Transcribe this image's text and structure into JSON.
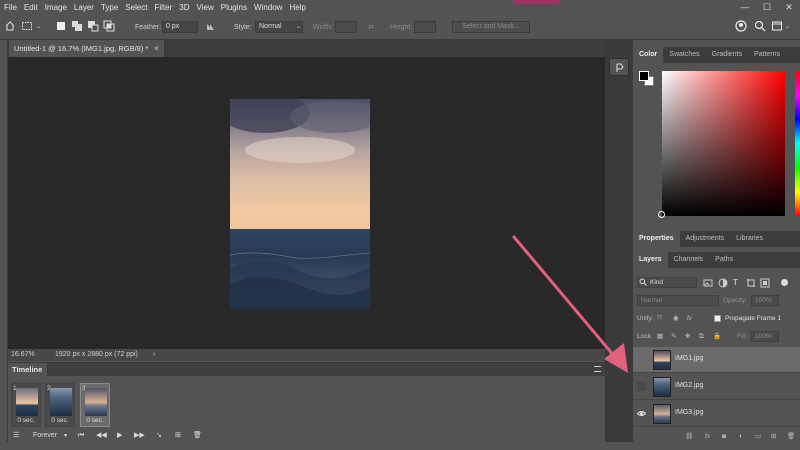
{
  "menu": [
    "File",
    "Edit",
    "Image",
    "Layer",
    "Type",
    "Select",
    "Filter",
    "3D",
    "View",
    "Plugins",
    "Window",
    "Help"
  ],
  "window_controls": [
    "—",
    "☐",
    "✕"
  ],
  "options_bar": {
    "feather_label": "Feather:",
    "feather_value": "0 px",
    "style_label": "Style:",
    "style_value": "Normal",
    "width_label": "Width:",
    "height_label": "Height:",
    "select_mask_label": "Select and Mask..."
  },
  "document": {
    "tab_title": "Untitled-1 @ 16.7% (IMG1.jpg, RGB/8) *",
    "close_glyph": "×"
  },
  "status_bar": {
    "zoom": "16.67%",
    "doc_size": "1920 px x 2880 px (72 ppi)",
    "arrow": "›"
  },
  "timeline": {
    "tab_label": "Timeline",
    "frames": [
      {
        "number": "1",
        "delay": "0 sec.",
        "selected": false
      },
      {
        "number": "2",
        "delay": "0 sec.",
        "selected": false
      },
      {
        "number": "3",
        "delay": "0 sec.",
        "selected": true
      }
    ],
    "loop_value": "Forever"
  },
  "color_panel": {
    "tabs": [
      "Color",
      "Swatches",
      "Gradients",
      "Patterns"
    ],
    "active_tab": 0,
    "foreground": "#000000",
    "background": "#ffffff",
    "hue": "#ff0000"
  },
  "properties_panel": {
    "tabs": [
      "Properties",
      "Adjustments",
      "Libraries"
    ],
    "active_tab": 0
  },
  "layers_panel": {
    "tabs": [
      "Layers",
      "Channels",
      "Paths"
    ],
    "active_tab": 0,
    "filter_kind": "Kind",
    "blend_mode": "Normal",
    "opacity_label": "Opacity:",
    "opacity_value": "100%",
    "unify_label": "Unify:",
    "propagate_label": "Propagate Frame 1",
    "lock_label": "Lock:",
    "fill_label": "Fill:",
    "fill_value": "100%",
    "layers": [
      {
        "name": "IMG1.jpg",
        "visible": false,
        "selected": true
      },
      {
        "name": "IMG2.jpg",
        "visible": false,
        "selected": false
      },
      {
        "name": "IMG3.jpg",
        "visible": true,
        "selected": false
      }
    ]
  },
  "colors": {
    "app_bg": "#535353",
    "canvas_bg": "#282828",
    "accent": "#a5325e",
    "annotation_arrow": "#e0607e"
  }
}
